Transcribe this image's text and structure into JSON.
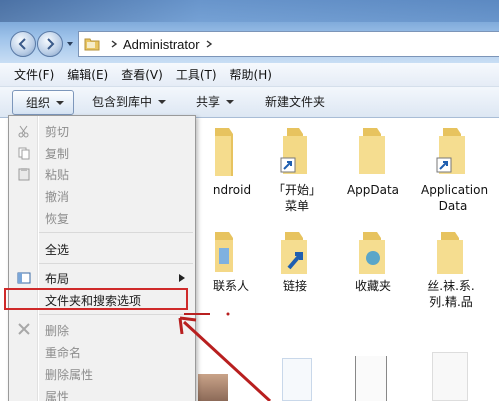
{
  "address": {
    "path": "Administrator"
  },
  "menubar": {
    "items": [
      "文件(F)",
      "编辑(E)",
      "查看(V)",
      "工具(T)",
      "帮助(H)"
    ]
  },
  "toolbar": {
    "organize": "组织",
    "include": "包含到库中",
    "share": "共享",
    "new_folder": "新建文件夹"
  },
  "files": [
    {
      "label": "Android",
      "visible_label": "ndroid"
    },
    {
      "label": "「开始」菜单"
    },
    {
      "label": "AppData"
    },
    {
      "label": "Application Data"
    },
    {
      "label": "联系人"
    },
    {
      "label": "链接"
    },
    {
      "label": "收藏夹"
    },
    {
      "label": "丝.袜.系.列.精.品"
    }
  ],
  "context_menu": {
    "cut": "剪切",
    "copy": "复制",
    "paste": "粘贴",
    "undo": "撤消",
    "redo": "恢复",
    "select_all": "全选",
    "layout": "布局",
    "folder_options": "文件夹和搜索选项",
    "delete": "删除",
    "rename": "重命名",
    "remove_properties": "删除属性",
    "properties": "属性"
  },
  "colors": {
    "highlight_border": "#cf2a2a",
    "arrow": "#b81f1f",
    "folder": "#f0d27a"
  }
}
